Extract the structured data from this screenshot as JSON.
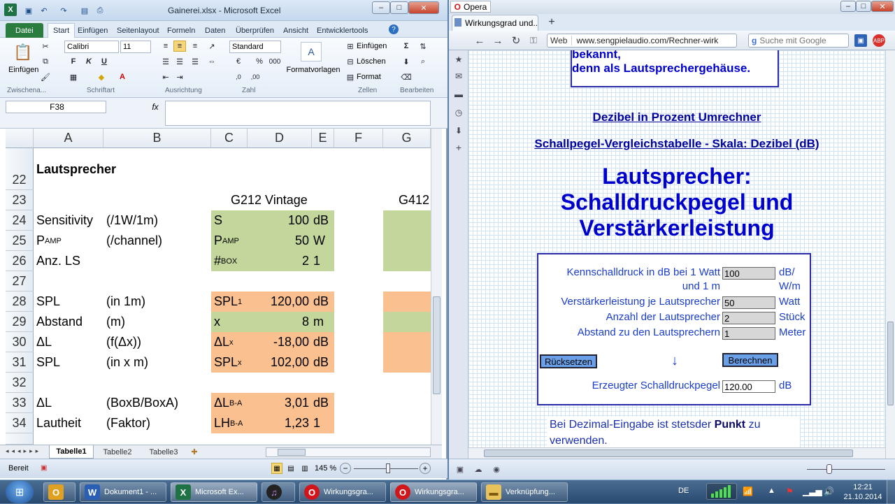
{
  "excel": {
    "title": "Gainerei.xlsx - Microsoft Excel",
    "tabs": [
      "Datei",
      "Start",
      "Einfügen",
      "Seitenlayout",
      "Formeln",
      "Daten",
      "Überprüfen",
      "Ansicht",
      "Entwicklertools"
    ],
    "ribbon": {
      "paste_label": "Einfügen",
      "font_name": "Calibri",
      "font_size": "11",
      "number_format": "Standard",
      "format_templates": "Formatvorlagen",
      "insert": "Einfügen",
      "delete": "Löschen",
      "format": "Format",
      "groups": [
        "Zwischena...",
        "Schriftart",
        "Ausrichtung",
        "Zahl",
        "Zellen",
        "Bearbeiten"
      ]
    },
    "name_box": "F38",
    "fx": "fx",
    "columns": [
      "A",
      "B",
      "C",
      "D",
      "E",
      "F",
      "G"
    ],
    "rows": [
      {
        "num": "22",
        "a": "Lautsprecher"
      },
      {
        "num": "23",
        "c": "G212 Vintage",
        "g": "G412"
      },
      {
        "num": "24",
        "a": "Sensitivity",
        "b": "(/1W/1m)",
        "c": "S",
        "d": "100",
        "e": "dB"
      },
      {
        "num": "25",
        "a": "P",
        "a_sub": "AMP",
        "b": "(/channel)",
        "c": "P",
        "c_sub": "AMP",
        "d": "50",
        "e": "W"
      },
      {
        "num": "26",
        "a": "Anz. LS",
        "c": "#",
        "c_sub": "BOX",
        "d": "2",
        "e": "1"
      },
      {
        "num": "27"
      },
      {
        "num": "28",
        "a": "SPL",
        "b": "(in 1m)",
        "c": "SPL",
        "c_sub": "1",
        "d": "120,00",
        "e": "dB"
      },
      {
        "num": "29",
        "a": "Abstand",
        "b": "(m)",
        "c": "x",
        "d": "8",
        "e": "m"
      },
      {
        "num": "30",
        "a": "ΔL",
        "b": "(f(Δx))",
        "c": "ΔL",
        "c_sub": "x",
        "d": "-18,00",
        "e": "dB"
      },
      {
        "num": "31",
        "a": "SPL",
        "b": "(in x m)",
        "c": "SPL",
        "c_sub": "x",
        "d": "102,00",
        "e": "dB"
      },
      {
        "num": "32"
      },
      {
        "num": "33",
        "a": "ΔL",
        "b": "(BoxB/BoxA)",
        "c": "ΔL",
        "c_sub": "B-A",
        "d": "3,01",
        "e": "dB"
      },
      {
        "num": "34",
        "a": "Lautheit",
        "b": "(Faktor)",
        "c": "LH",
        "c_sub": "B-A",
        "d": "1,23",
        "e": "1"
      }
    ],
    "sheets": [
      "Tabelle1",
      "Tabelle2",
      "Tabelle3"
    ],
    "status": "Bereit",
    "zoom": "145 %"
  },
  "opera": {
    "app": "Opera",
    "tab_title": "Wirkungsgrad und...",
    "web_label": "Web",
    "url": "www.sengpielaudio.com/Rechner-wirk",
    "search_placeholder": "Suche mit Google",
    "page": {
      "box_text1": "bekannt,",
      "box_text2": "denn als Lautsprechergehäuse.",
      "link1": "Dezibel in Prozent Umrechner",
      "link2": "Schallpegel-Vergleichstabelle - Skala: Dezibel (dB)",
      "heading1": "Lautsprecher:",
      "heading2": "Schalldruckpegel und",
      "heading3": "Verstärkerleistung",
      "form": {
        "l1a": "Kennschalldruck in dB bei 1 Watt",
        "l1b": "und 1 m",
        "v1": "100",
        "u1a": "dB/",
        "u1b": "W/m",
        "l2": "Verstärkerleistung je Lautsprecher",
        "v2": "50",
        "u2": "Watt",
        "l3": "Anzahl der Lautsprecher",
        "v3": "2",
        "u3": "Stück",
        "l4": "Abstand zu den Lautsprechern",
        "v4": "1",
        "u4": "Meter",
        "reset": "Rücksetzen",
        "arrow": "↓",
        "calc": "Berechnen",
        "result_label": "Erzeugter Schalldruckpegel",
        "result": "120.00",
        "result_unit": "dB"
      },
      "note_a": "Bei Dezimal-Eingabe ist stets",
      "note_b": "der ",
      "note_bold": "Punkt",
      "note_c": " zu",
      "note_d": "verwenden."
    }
  },
  "taskbar": {
    "items": [
      "Dokument1 - ...",
      "Microsoft Ex...",
      "Wirkungsgra...",
      "Wirkungsgra...",
      "Verknüpfung..."
    ],
    "lang": "DE",
    "time": "12:21",
    "date": "21.10.2014"
  },
  "colors": {
    "green": "#c3d69b",
    "orange": "#fac090",
    "link": "#00009c",
    "heading": "#0000cc"
  }
}
